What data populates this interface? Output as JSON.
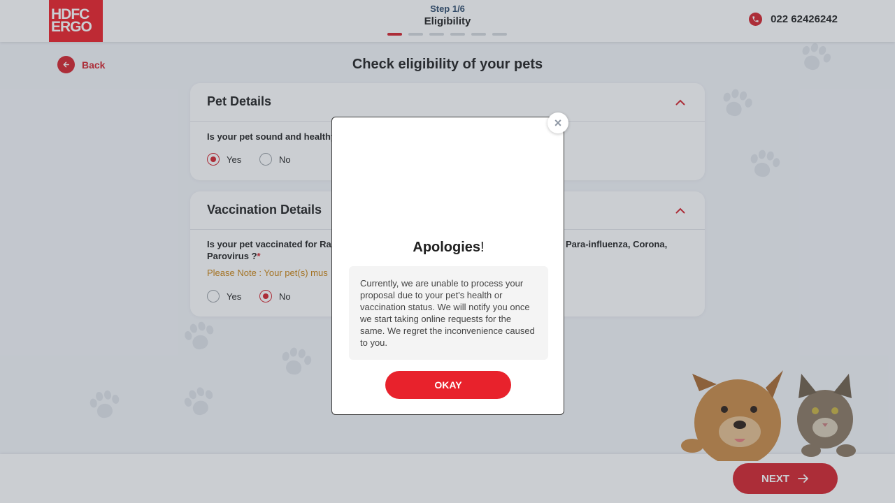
{
  "header": {
    "logo_line1": "HDFC",
    "logo_line2": "ERGO",
    "step_label": "Step 1/6",
    "step_title": "Eligibility",
    "progress": {
      "current": 1,
      "total": 6
    },
    "phone_icon": "phone-icon",
    "phone_number": "022 62426242"
  },
  "nav": {
    "back_label": "Back"
  },
  "page_title": "Check eligibility of your pets",
  "sections": [
    {
      "title": "Pet Details",
      "question": "Is your pet sound and healthy",
      "options": [
        "Yes",
        "No"
      ],
      "selected": "Yes"
    },
    {
      "title": "Vaccination Details",
      "question_start": "Is your pet vaccinated for Ra",
      "question_end": "Para-influenza, Corona,",
      "question_line2": "Parovirus ?",
      "required_mark": "*",
      "note": "Please Note : Your pet(s) mus",
      "options": [
        "Yes",
        "No"
      ],
      "selected": "No"
    }
  ],
  "footer": {
    "next_label": "NEXT"
  },
  "modal": {
    "title": "Apologies",
    "title_mark": "!",
    "message": "Currently, we are unable to process your proposal due to your pet's health or vaccination status. We will notify you once we start taking online requests for the same. We regret the inconvenience caused to you.",
    "okay_label": "OKAY",
    "close_symbol": "×"
  },
  "colors": {
    "brand_red": "#d4202a",
    "note_orange": "#c9820f"
  }
}
